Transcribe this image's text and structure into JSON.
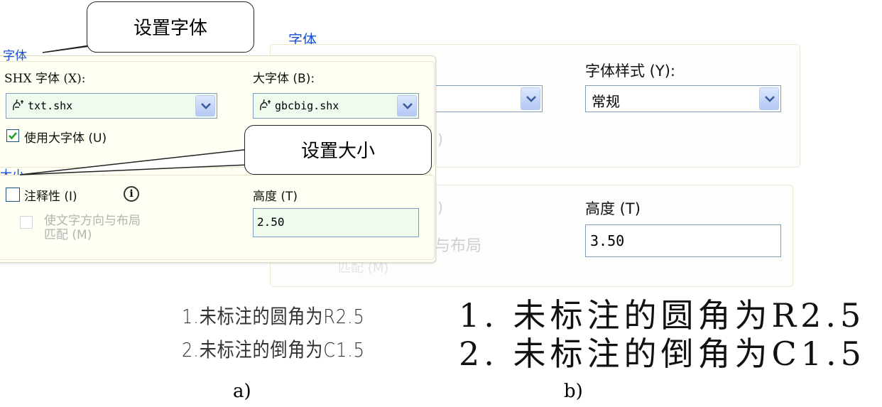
{
  "back_panel": {
    "font_section_title": "字体",
    "font_style_label": "字体样式 (Y):",
    "font_style_value": "常规",
    "partial_paren_1": ")",
    "partial_paren_2": ")",
    "height_label": "高度 (T)",
    "height_value": "3.50",
    "layout_fragment": "与布局",
    "fragment_bottom": "匹配 (M)"
  },
  "front_panel": {
    "font_section_title": "字体",
    "shx_font_label": "SHX 字体 (X):",
    "shx_font_value": "txt.shx",
    "big_font_label": "大字体 (B):",
    "big_font_value": "gbcbig.shx",
    "use_big_font_label": "使用大字体 (U)",
    "use_big_font_checked": true,
    "size_section_title": "大小",
    "annotative_label": "注释性 (I)",
    "annotative_checked": false,
    "info_glyph": "i",
    "match_orientation_label_line1": "使文字方向与布局",
    "match_orientation_label_line2": "匹配 (M)",
    "height_label": "高度 (T)",
    "height_value": "2.50"
  },
  "callouts": {
    "font": "设置字体",
    "size": "设置大小"
  },
  "samples": {
    "a_line1": "1.未标注的圆角为R2.5",
    "a_line2": "2.未标注的倒角为C1.5",
    "b_line1": "1. 未标注的圆角为R2.5",
    "b_line2": "2. 未标注的倒角为C1.5"
  },
  "captions": {
    "a": "a)",
    "b": "b)"
  },
  "colors": {
    "section_title": "#1a4fd6",
    "field_bg": "#eefbee",
    "panel_bg": "#fffff3",
    "checkbox_check": "#21a121"
  }
}
